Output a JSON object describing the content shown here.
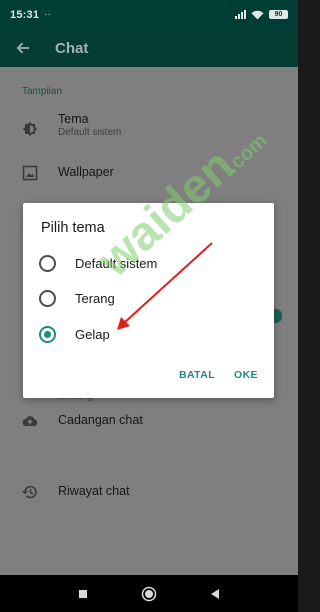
{
  "status_bar": {
    "time": "15:31",
    "left_icons": "··",
    "battery": "90"
  },
  "app_bar": {
    "title": "Chat",
    "back_icon": "arrow-back-icon"
  },
  "settings": {
    "section_display": "Tampilan",
    "theme": {
      "title": "Tema",
      "subtitle": "Default sistem",
      "icon": "theme-icon"
    },
    "wallpaper": {
      "title": "Wallpaper",
      "icon": "wallpaper-icon"
    },
    "partial_s": "S",
    "font_size_value": "Sedang",
    "backup": {
      "title": "Cadangan chat",
      "icon": "cloud-upload-icon"
    },
    "history": {
      "title": "Riwayat chat",
      "icon": "history-icon"
    }
  },
  "dialog": {
    "title": "Pilih tema",
    "options": [
      {
        "label": "Default sistem",
        "checked": false
      },
      {
        "label": "Terang",
        "checked": false
      },
      {
        "label": "Gelap",
        "checked": true
      }
    ],
    "cancel_label": "BATAL",
    "ok_label": "OKE"
  },
  "watermark": {
    "text": "waiden",
    "domain": ".com"
  },
  "colors": {
    "accent": "#1d8c78",
    "annotation_arrow": "#e01e1e",
    "app_bar": "#053c34"
  }
}
